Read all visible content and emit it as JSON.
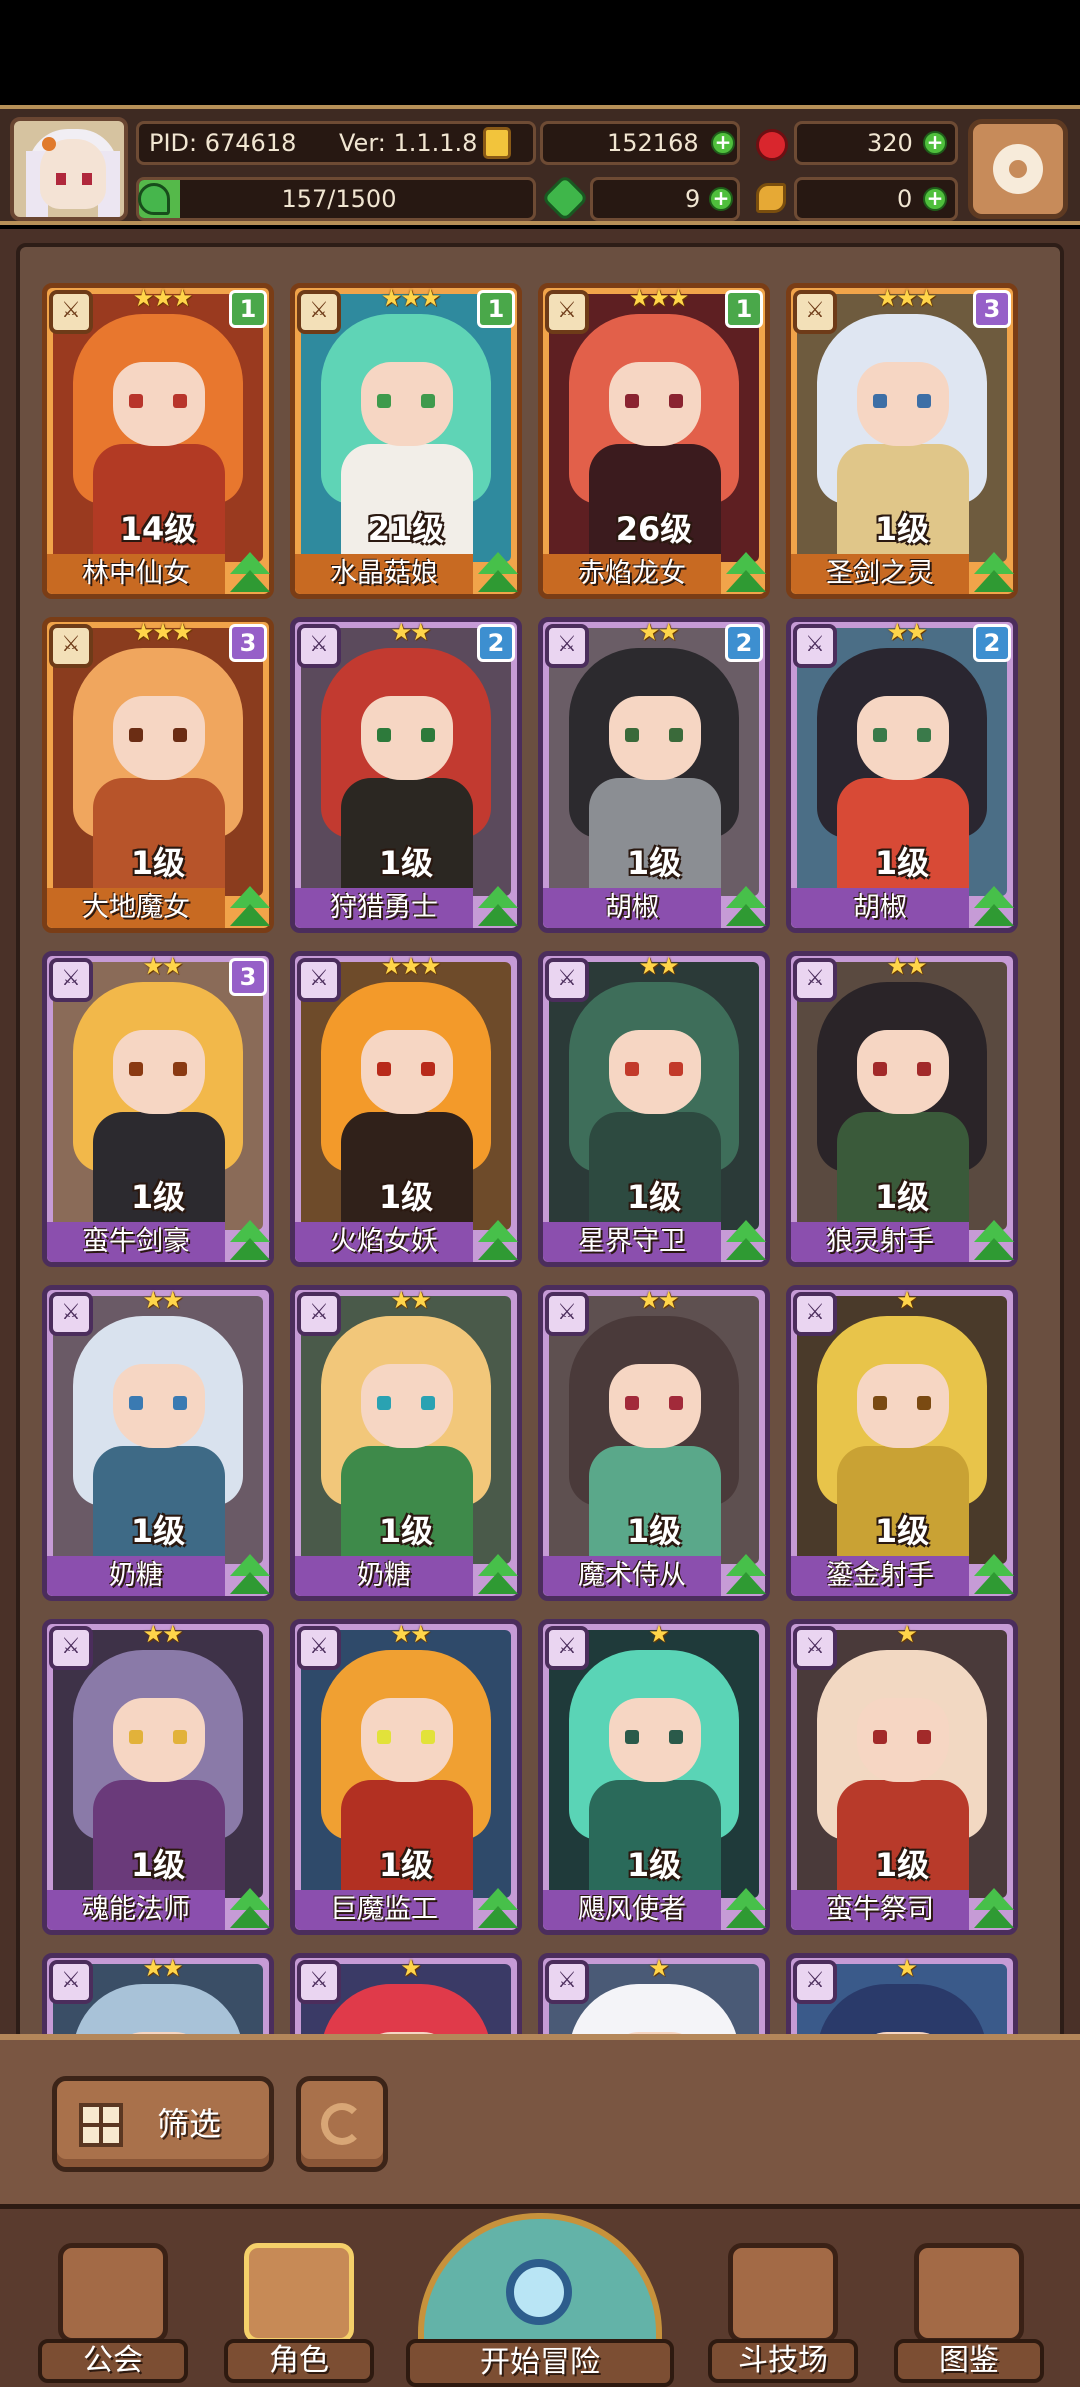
{
  "header": {
    "pid": "PID: 674618",
    "version": "Ver: 1.1.1.8",
    "gold": "152168",
    "rubies": "320",
    "energy_text": "157/1500",
    "energy_fraction": 0.105,
    "clovers": "9",
    "keys": "0"
  },
  "cards": [
    {
      "frame": "gold",
      "stars": "★★★",
      "rank": "1",
      "rank_color": "green",
      "level": "14级",
      "name": "林中仙女",
      "hair": "#e8772e",
      "body": "#b23a24",
      "bg": "#9a3a1f",
      "eye": "#b8352b"
    },
    {
      "frame": "gold",
      "stars": "★★★",
      "rank": "1",
      "rank_color": "green",
      "level": "21级",
      "name": "水晶菇娘",
      "hair": "#5fd4b6",
      "body": "#f2eee8",
      "bg": "#2f8a9e",
      "eye": "#3f9a4c"
    },
    {
      "frame": "gold",
      "stars": "★★★",
      "rank": "1",
      "rank_color": "green",
      "level": "26级",
      "name": "赤焰龙女",
      "hair": "#e2604a",
      "body": "#3b1b1e",
      "bg": "#5e1f22",
      "eye": "#8a2330"
    },
    {
      "frame": "gold",
      "stars": "★★★",
      "rank": "3",
      "rank_color": "violet",
      "level": "1级",
      "name": "圣剑之灵",
      "hair": "#dfe6f2",
      "body": "#e0c689",
      "bg": "#6e5b3e",
      "eye": "#3d6fa6"
    },
    {
      "frame": "gold",
      "stars": "★★★",
      "rank": "3",
      "rank_color": "violet",
      "level": "1级",
      "name": "大地魔女",
      "hair": "#f0a65e",
      "body": "#b7542a",
      "bg": "#8a3c1e",
      "eye": "#6b2d14"
    },
    {
      "frame": "purple",
      "stars": "★★",
      "rank": "2",
      "rank_color": "blue",
      "level": "1级",
      "name": "狩猎勇士",
      "hair": "#c23a30",
      "body": "#2b2722",
      "bg": "#5b4a5c",
      "eye": "#2d7a3b"
    },
    {
      "frame": "purple",
      "stars": "★★",
      "rank": "2",
      "rank_color": "blue",
      "level": "1级",
      "name": "胡椒",
      "hair": "#2c2a2e",
      "body": "#8b8e93",
      "bg": "#6a5d66",
      "eye": "#3a6a3a"
    },
    {
      "frame": "purple",
      "stars": "★★",
      "rank": "2",
      "rank_color": "blue",
      "level": "1级",
      "name": "胡椒",
      "hair": "#2a2630",
      "body": "#d84a36",
      "bg": "#4b6e86",
      "eye": "#3a7a4a"
    },
    {
      "frame": "purple",
      "stars": "★★",
      "rank": "3",
      "rank_color": "violet",
      "level": "1级",
      "name": "蛮牛剑豪",
      "hair": "#f2b84a",
      "body": "#2c2a2f",
      "bg": "#8a6b58",
      "eye": "#8a3a12"
    },
    {
      "frame": "purple",
      "stars": "★★★",
      "rank": "",
      "rank_color": "",
      "level": "1级",
      "name": "火焰女妖",
      "hair": "#f39a2a",
      "body": "#30211a",
      "bg": "#6e4b2a",
      "eye": "#b82a1a"
    },
    {
      "frame": "purple",
      "stars": "★★",
      "rank": "",
      "rank_color": "",
      "level": "1级",
      "name": "星界守卫",
      "hair": "#3e6e5a",
      "body": "#2d4a40",
      "bg": "#2b3a38",
      "eye": "#c23a2a"
    },
    {
      "frame": "purple",
      "stars": "★★",
      "rank": "",
      "rank_color": "",
      "level": "1级",
      "name": "狼灵射手",
      "hair": "#2a2428",
      "body": "#3a5a3a",
      "bg": "#5a4a40",
      "eye": "#a22a2a"
    },
    {
      "frame": "purple",
      "stars": "★★",
      "rank": "",
      "rank_color": "",
      "level": "1级",
      "name": "奶糖",
      "hair": "#d9e2ee",
      "body": "#3e6a86",
      "bg": "#6a5a66",
      "eye": "#3a7ab2"
    },
    {
      "frame": "purple",
      "stars": "★★",
      "rank": "",
      "rank_color": "",
      "level": "1级",
      "name": "奶糖",
      "hair": "#f2c77a",
      "body": "#3e8a4a",
      "bg": "#4a5a4a",
      "eye": "#2aa2b2"
    },
    {
      "frame": "purple",
      "stars": "★★",
      "rank": "",
      "rank_color": "",
      "level": "1级",
      "name": "魔术侍从",
      "hair": "#4a3a3a",
      "body": "#5aa88a",
      "bg": "#5e5050",
      "eye": "#a22a3a"
    },
    {
      "frame": "purple",
      "stars": "★",
      "rank": "",
      "rank_color": "",
      "level": "1级",
      "name": "鎏金射手",
      "hair": "#e8c44a",
      "body": "#c9a234",
      "bg": "#4a3a2a",
      "eye": "#7a4a12"
    },
    {
      "frame": "purple",
      "stars": "★★",
      "rank": "",
      "rank_color": "",
      "level": "1级",
      "name": "魂能法师",
      "hair": "#8a7aa8",
      "body": "#6a3a7a",
      "bg": "#3e3248",
      "eye": "#e2b23a"
    },
    {
      "frame": "purple",
      "stars": "★★",
      "rank": "",
      "rank_color": "",
      "level": "1级",
      "name": "巨魔监工",
      "hair": "#f0a032",
      "body": "#b23022",
      "bg": "#2f4a6a",
      "eye": "#e2e23a"
    },
    {
      "frame": "purple",
      "stars": "★",
      "rank": "",
      "rank_color": "",
      "level": "1级",
      "name": "飓风使者",
      "hair": "#5ad4b6",
      "body": "#2a6a5a",
      "bg": "#1f3a3a",
      "eye": "#2a5a4a"
    },
    {
      "frame": "purple",
      "stars": "★",
      "rank": "",
      "rank_color": "",
      "level": "1级",
      "name": "蛮牛祭司",
      "hair": "#f2d8c2",
      "body": "#b83a2a",
      "bg": "#4a3a3a",
      "eye": "#a22a2a"
    },
    {
      "frame": "purple",
      "stars": "★★",
      "rank": "",
      "rank_color": "",
      "level": "",
      "name": "",
      "hair": "#a8c2d8",
      "body": "#6a8aa2",
      "bg": "#3a4e66",
      "eye": "#3a8a3a"
    },
    {
      "frame": "purple",
      "stars": "★",
      "rank": "",
      "rank_color": "",
      "level": "",
      "name": "",
      "hair": "#e03a4a",
      "body": "#b02a3a",
      "bg": "#3a3a66",
      "eye": "#a22a2a"
    },
    {
      "frame": "purple",
      "stars": "★",
      "rank": "",
      "rank_color": "",
      "level": "",
      "name": "",
      "hair": "#f4f4f8",
      "body": "#d8dce6",
      "bg": "#4a5a76",
      "eye": "#3a5a8a"
    },
    {
      "frame": "purple",
      "stars": "★",
      "rank": "",
      "rank_color": "",
      "level": "",
      "name": "",
      "hair": "#2a3a6a",
      "body": "#2a2a4a",
      "bg": "#3a5a8a",
      "eye": "#3a8a3a"
    }
  ],
  "controls": {
    "filter_label": "筛选"
  },
  "nav": {
    "guild": "公会",
    "characters": "角色",
    "start_adventure": "开始冒险",
    "arena": "斗技场",
    "codex": "图鉴"
  },
  "colors": {
    "gold_frame": "#f1a44a",
    "purple_frame": "#c69bd6",
    "upgrade_green": "#47c04a"
  }
}
